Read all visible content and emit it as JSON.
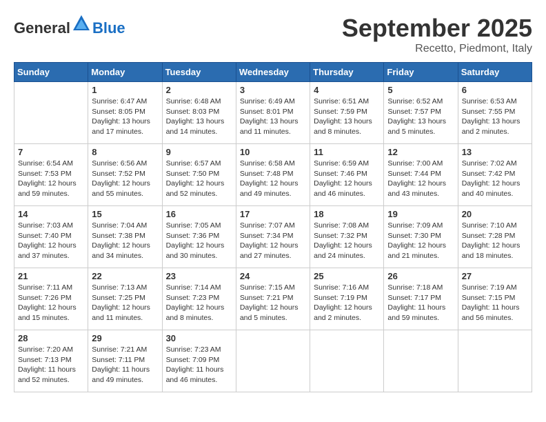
{
  "header": {
    "logo_general": "General",
    "logo_blue": "Blue",
    "month": "September 2025",
    "location": "Recetto, Piedmont, Italy"
  },
  "weekdays": [
    "Sunday",
    "Monday",
    "Tuesday",
    "Wednesday",
    "Thursday",
    "Friday",
    "Saturday"
  ],
  "weeks": [
    [
      {
        "day": "",
        "info": ""
      },
      {
        "day": "1",
        "info": "Sunrise: 6:47 AM\nSunset: 8:05 PM\nDaylight: 13 hours\nand 17 minutes."
      },
      {
        "day": "2",
        "info": "Sunrise: 6:48 AM\nSunset: 8:03 PM\nDaylight: 13 hours\nand 14 minutes."
      },
      {
        "day": "3",
        "info": "Sunrise: 6:49 AM\nSunset: 8:01 PM\nDaylight: 13 hours\nand 11 minutes."
      },
      {
        "day": "4",
        "info": "Sunrise: 6:51 AM\nSunset: 7:59 PM\nDaylight: 13 hours\nand 8 minutes."
      },
      {
        "day": "5",
        "info": "Sunrise: 6:52 AM\nSunset: 7:57 PM\nDaylight: 13 hours\nand 5 minutes."
      },
      {
        "day": "6",
        "info": "Sunrise: 6:53 AM\nSunset: 7:55 PM\nDaylight: 13 hours\nand 2 minutes."
      }
    ],
    [
      {
        "day": "7",
        "info": "Sunrise: 6:54 AM\nSunset: 7:53 PM\nDaylight: 12 hours\nand 59 minutes."
      },
      {
        "day": "8",
        "info": "Sunrise: 6:56 AM\nSunset: 7:52 PM\nDaylight: 12 hours\nand 55 minutes."
      },
      {
        "day": "9",
        "info": "Sunrise: 6:57 AM\nSunset: 7:50 PM\nDaylight: 12 hours\nand 52 minutes."
      },
      {
        "day": "10",
        "info": "Sunrise: 6:58 AM\nSunset: 7:48 PM\nDaylight: 12 hours\nand 49 minutes."
      },
      {
        "day": "11",
        "info": "Sunrise: 6:59 AM\nSunset: 7:46 PM\nDaylight: 12 hours\nand 46 minutes."
      },
      {
        "day": "12",
        "info": "Sunrise: 7:00 AM\nSunset: 7:44 PM\nDaylight: 12 hours\nand 43 minutes."
      },
      {
        "day": "13",
        "info": "Sunrise: 7:02 AM\nSunset: 7:42 PM\nDaylight: 12 hours\nand 40 minutes."
      }
    ],
    [
      {
        "day": "14",
        "info": "Sunrise: 7:03 AM\nSunset: 7:40 PM\nDaylight: 12 hours\nand 37 minutes."
      },
      {
        "day": "15",
        "info": "Sunrise: 7:04 AM\nSunset: 7:38 PM\nDaylight: 12 hours\nand 34 minutes."
      },
      {
        "day": "16",
        "info": "Sunrise: 7:05 AM\nSunset: 7:36 PM\nDaylight: 12 hours\nand 30 minutes."
      },
      {
        "day": "17",
        "info": "Sunrise: 7:07 AM\nSunset: 7:34 PM\nDaylight: 12 hours\nand 27 minutes."
      },
      {
        "day": "18",
        "info": "Sunrise: 7:08 AM\nSunset: 7:32 PM\nDaylight: 12 hours\nand 24 minutes."
      },
      {
        "day": "19",
        "info": "Sunrise: 7:09 AM\nSunset: 7:30 PM\nDaylight: 12 hours\nand 21 minutes."
      },
      {
        "day": "20",
        "info": "Sunrise: 7:10 AM\nSunset: 7:28 PM\nDaylight: 12 hours\nand 18 minutes."
      }
    ],
    [
      {
        "day": "21",
        "info": "Sunrise: 7:11 AM\nSunset: 7:26 PM\nDaylight: 12 hours\nand 15 minutes."
      },
      {
        "day": "22",
        "info": "Sunrise: 7:13 AM\nSunset: 7:25 PM\nDaylight: 12 hours\nand 11 minutes."
      },
      {
        "day": "23",
        "info": "Sunrise: 7:14 AM\nSunset: 7:23 PM\nDaylight: 12 hours\nand 8 minutes."
      },
      {
        "day": "24",
        "info": "Sunrise: 7:15 AM\nSunset: 7:21 PM\nDaylight: 12 hours\nand 5 minutes."
      },
      {
        "day": "25",
        "info": "Sunrise: 7:16 AM\nSunset: 7:19 PM\nDaylight: 12 hours\nand 2 minutes."
      },
      {
        "day": "26",
        "info": "Sunrise: 7:18 AM\nSunset: 7:17 PM\nDaylight: 11 hours\nand 59 minutes."
      },
      {
        "day": "27",
        "info": "Sunrise: 7:19 AM\nSunset: 7:15 PM\nDaylight: 11 hours\nand 56 minutes."
      }
    ],
    [
      {
        "day": "28",
        "info": "Sunrise: 7:20 AM\nSunset: 7:13 PM\nDaylight: 11 hours\nand 52 minutes."
      },
      {
        "day": "29",
        "info": "Sunrise: 7:21 AM\nSunset: 7:11 PM\nDaylight: 11 hours\nand 49 minutes."
      },
      {
        "day": "30",
        "info": "Sunrise: 7:23 AM\nSunset: 7:09 PM\nDaylight: 11 hours\nand 46 minutes."
      },
      {
        "day": "",
        "info": ""
      },
      {
        "day": "",
        "info": ""
      },
      {
        "day": "",
        "info": ""
      },
      {
        "day": "",
        "info": ""
      }
    ]
  ]
}
